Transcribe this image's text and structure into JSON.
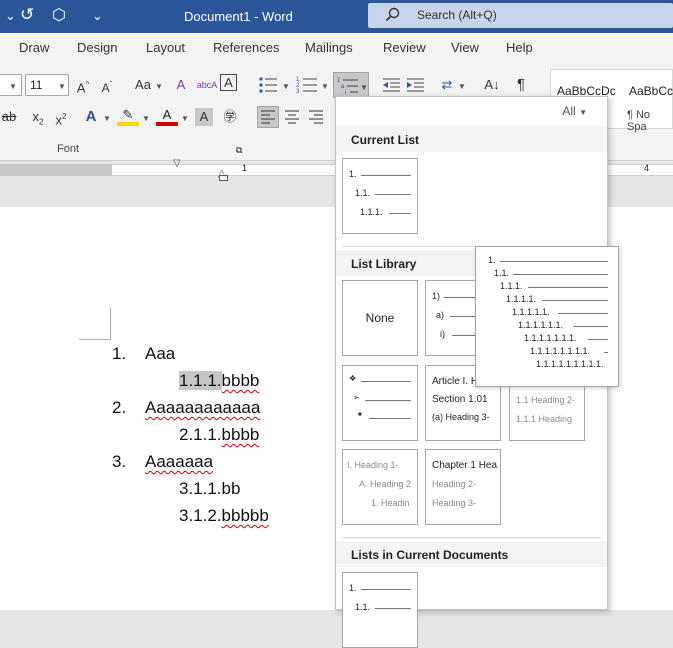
{
  "titlebar": {
    "doc_title": "Document1  -  Word",
    "search_placeholder": "Search (Alt+Q)"
  },
  "tabs": [
    "Draw",
    "Design",
    "Layout",
    "References",
    "Mailings",
    "Review",
    "View",
    "Help"
  ],
  "ribbon": {
    "font_size": "11",
    "font_group_label": "Font",
    "styles": [
      {
        "sample": "AaBbCcDc",
        "name": ""
      },
      {
        "sample": "AaBbCc",
        "name": "¶ No Spa"
      }
    ]
  },
  "ruler": {
    "marks": [
      "1",
      "4"
    ]
  },
  "document": {
    "lines": [
      {
        "number": "1.",
        "text": "Aaa"
      },
      {
        "number": "",
        "text": "1.1.1.",
        "tail": "bbbb"
      },
      {
        "number": "2.",
        "text": "Aaaaaaaaaaaa"
      },
      {
        "number": "",
        "text": "2.1.1.",
        "tail": "bbbb"
      },
      {
        "number": "3.",
        "text": "Aaaaaaa"
      },
      {
        "number": "",
        "text": "3.1.1.bb"
      },
      {
        "number": "",
        "text": "3.1.2.",
        "tail": "bbbbb"
      }
    ]
  },
  "panel": {
    "filter_label": "All",
    "sections": {
      "current_list": "Current List",
      "list_library": "List Library",
      "lists_in_docs": "Lists in Current Documents"
    },
    "current_list_levels": [
      "1.",
      "1.1.",
      "1.1.1."
    ],
    "none_label": "None",
    "library": {
      "paren": [
        "1)",
        "a)",
        "i)"
      ],
      "article": [
        "Article I. H",
        "Section 1.01",
        "(a) Heading 3-"
      ],
      "heading_r": [
        "1.1 Heading 2-",
        "1.1.1 Heading"
      ],
      "roman": [
        "I. Heading 1-",
        "A. Heading 2",
        "1. Headin"
      ],
      "chapter": [
        "Chapter 1 Hea",
        "Heading 2-",
        "Heading 3-"
      ]
    },
    "docs_levels": [
      "1.",
      "1.1."
    ]
  },
  "preview": {
    "levels": [
      "1.",
      "1.1.",
      "1.1.1.",
      "1.1.1.1.",
      "1.1.1.1.1.",
      "1.1.1.1.1.1.",
      "1.1.1.1.1.1.1.",
      "1.1.1.1.1.1.1.1.",
      "1.1.1.1.1.1.1.1.1."
    ]
  }
}
